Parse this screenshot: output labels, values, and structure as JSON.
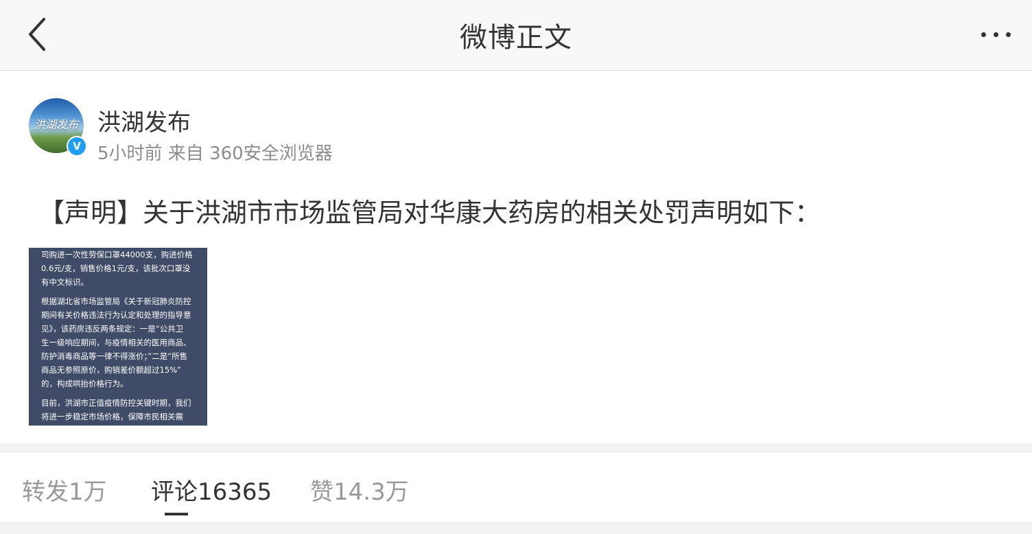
{
  "header": {
    "title": "微博正文",
    "back_icon": "chevron-left-icon",
    "more_icon": "more-horizontal-icon"
  },
  "post": {
    "avatar": {
      "text": "洪湖发布",
      "badge_icon": "verified-icon",
      "badge_text": "V"
    },
    "user_name": "洪湖发布",
    "meta": "5小时前 来自 360安全浏览器",
    "text": "【声明】关于洪湖市市场监管局对华康大药房的相关处罚声明如下：",
    "image_lines": [
      "司购进一次性劳保口罩44000支，购进价格\n0.6元/支，销售价格1元/支，该批次口罩没\n有中文标识。",
      "根据湖北省市场监管局《关于新冠肺炎防控\n期间有关价格违法行为认定和处理的指导意\n见》，该药房违反两条规定：一是“公共卫\n生一级响应期间，与疫情相关的医用商品、\n防护消毒商品等一律不得涨价；”二是“所售\n商品无参照原价，购销差价额超过15%”\n的，构成哄抬价格行为。",
      "目前，洪湖市正值疫情防控关键时期，我们\n将进一步稳定市场价格，保障市民相关需"
    ]
  },
  "tabs": [
    {
      "label": "转发1万",
      "active": false
    },
    {
      "label": "评论16365",
      "active": true
    },
    {
      "label": "赞14.3万",
      "active": false
    }
  ],
  "colors": {
    "accent": "#333333",
    "meta_gray": "#8c8c8c",
    "verified_blue": "#1e9ff2",
    "image_bg": "#3f4b67"
  }
}
